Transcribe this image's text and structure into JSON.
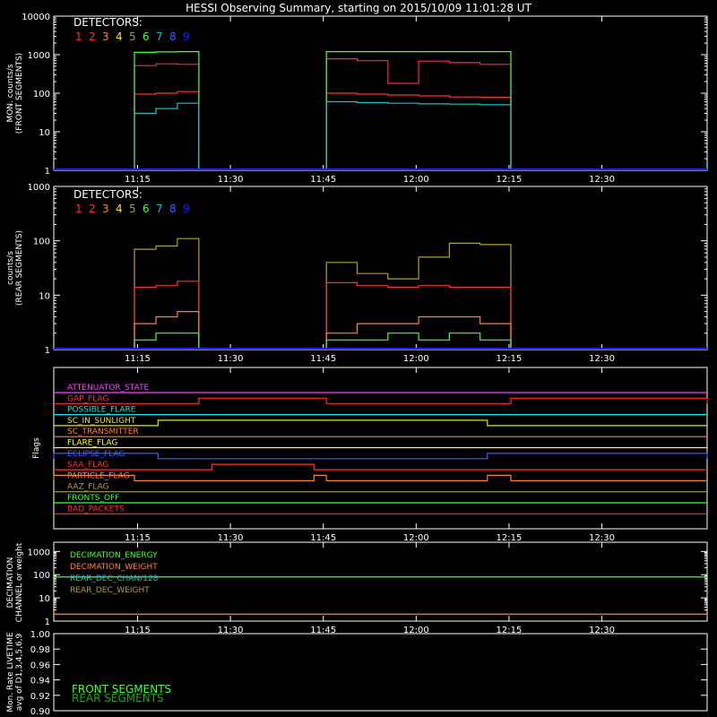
{
  "title": "HESSI Observing Summary, starting on 2015/10/09 11:01:28 UT",
  "colors": {
    "bg": "#000000",
    "axis": "#ffffff",
    "det": [
      "#ff2060",
      "#ff3030",
      "#ff8040",
      "#ffe040",
      "#b0a030",
      "#40ff40",
      "#20c0c0",
      "#4060ff",
      "#2020ff"
    ]
  },
  "x_ticks": [
    "11:15",
    "11:30",
    "11:45",
    "12:00",
    "12:15",
    "12:30"
  ],
  "x_tick_minutes": [
    15,
    30,
    45,
    60,
    75,
    90
  ],
  "x_range_minutes": [
    1.47,
    107
  ],
  "panels": {
    "front": {
      "ylabel_1": "MON. counts/s",
      "ylabel_2": "(FRONT SEGMENTS)",
      "yticks": [
        "1",
        "10",
        "100",
        "1000",
        "10000"
      ],
      "legend_title": "DETECTORS:",
      "legend_numbers": [
        "1",
        "2",
        "3",
        "4",
        "5",
        "6",
        "7",
        "8",
        "9"
      ]
    },
    "rear": {
      "ylabel_1": "counts/s",
      "ylabel_2": "(REAR SEGMENTS)",
      "yticks": [
        "1",
        "10",
        "100",
        "1000"
      ],
      "legend_title": "DETECTORS:",
      "legend_numbers": [
        "1",
        "2",
        "3",
        "4",
        "5",
        "6",
        "7",
        "8",
        "9"
      ]
    },
    "flags": {
      "ylabel": "Flags",
      "labels": [
        "ATTENUATOR_STATE",
        "GAP_FLAG",
        "POSSIBLE_FLARE",
        "SC_IN_SUNLIGHT",
        "SC_TRANSMITTER",
        "FLARE_FLAG",
        "ECLIPSE_FLAG",
        "SAA_FLAG",
        "PARTICLE_FLAG",
        "AAZ_FLAG",
        "FRONTS_OFF",
        "BAD_PACKETS"
      ],
      "label_colors": [
        "#ff40ff",
        "#ff3030",
        "#20e0e0",
        "#e0e040",
        "#ff8040",
        "#ffff40",
        "#4060ff",
        "#ff3030",
        "#ff8040",
        "#b0a030",
        "#40ff40",
        "#ff3030"
      ]
    },
    "decimation": {
      "ylabel_1": "DECIMATION",
      "ylabel_2": "CHANNEL or weight",
      "yticks": [
        "1",
        "10",
        "100",
        "1000"
      ],
      "labels": [
        "DECIMATION_ENERGY",
        "DECIMATION_WEIGHT",
        "REAR_DEC_CHAN/128",
        "REAR_DEC_WEIGHT"
      ],
      "label_colors": [
        "#40ff40",
        "#ff8040",
        "#20c0c0",
        "#b0a030"
      ]
    },
    "livetime": {
      "ylabel_1": "Mon. Rate LIVETIME",
      "ylabel_2": "avg of D1,3,4,5,6,9",
      "yticks": [
        "0.90",
        "0.92",
        "0.94",
        "0.96",
        "0.98",
        "1.00"
      ],
      "labels": [
        "FRONT SEGMENTS",
        "REAR SEGMENTS"
      ],
      "label_colors": [
        "#40ff40",
        "#20a020"
      ]
    }
  },
  "chart_data": [
    {
      "type": "line",
      "title": "HESSI Observing Summary, starting on 2015/10/09 11:01:28 UT",
      "ylabel": "MON. counts/s (FRONT SEGMENTS)",
      "yscale": "log",
      "ylim": [
        1,
        10000
      ],
      "x_unit": "minutes after 11:00 UT",
      "xlim": [
        1.47,
        107
      ],
      "intervals": [
        [
          14.5,
          24.9
        ],
        [
          45.5,
          75.3
        ]
      ],
      "series": [
        {
          "name": "1",
          "values_int1": [
            520,
            580,
            560
          ],
          "values_int2": [
            780,
            700,
            180,
            680,
            620,
            560
          ]
        },
        {
          "name": "2",
          "values_int1": [
            95,
            100,
            110
          ],
          "values_int2": [
            100,
            95,
            90,
            85,
            80,
            78
          ]
        },
        {
          "name": "6",
          "values_int1": [
            1150,
            1180,
            1200
          ],
          "values_int2": [
            1200,
            1200,
            1200,
            1200,
            1200,
            1200
          ]
        },
        {
          "name": "7",
          "values_int1": [
            30,
            40,
            55
          ],
          "values_int2": [
            60,
            57,
            55,
            53,
            52,
            50
          ]
        }
      ]
    },
    {
      "type": "line",
      "ylabel": "counts/s (REAR SEGMENTS)",
      "yscale": "log",
      "ylim": [
        1,
        1000
      ],
      "x_unit": "minutes after 11:00 UT",
      "intervals": [
        [
          14.5,
          24.9
        ],
        [
          45.5,
          75.3
        ]
      ],
      "series": [
        {
          "name": "5",
          "values_int1": [
            70,
            80,
            110
          ],
          "values_int2": [
            40,
            25,
            20,
            50,
            90,
            85
          ]
        },
        {
          "name": "2",
          "values_int1": [
            14,
            15,
            18
          ],
          "values_int2": [
            17,
            15,
            14,
            15,
            14,
            14
          ]
        },
        {
          "name": "3",
          "values_int1": [
            3,
            4,
            5
          ],
          "values_int2": [
            2,
            3,
            3,
            4,
            4,
            3
          ]
        },
        {
          "name": "6",
          "values_int1": [
            1.5,
            2,
            2
          ],
          "values_int2": [
            1.5,
            1.5,
            2,
            1.5,
            2,
            1.5
          ]
        }
      ]
    },
    {
      "type": "line",
      "ylabel": "Flags",
      "x_unit": "minutes after 11:00 UT",
      "flags": [
        {
          "name": "GAP_FLAG",
          "on": [
            [
              24.9,
              45.5
            ],
            [
              75.3,
              107
            ]
          ]
        },
        {
          "name": "SC_IN_SUNLIGHT",
          "on": [
            [
              18.3,
              71.5
            ]
          ]
        },
        {
          "name": "ECLIPSE_FLAG",
          "on": [
            [
              1.47,
              18.3
            ],
            [
              71.5,
              107
            ]
          ]
        },
        {
          "name": "SAA_FLAG",
          "on": [
            [
              27,
              43.5
            ]
          ]
        },
        {
          "name": "PARTICLE_FLAG",
          "on": [
            [
              1.47,
              14.5
            ],
            [
              43.5,
              45.5
            ],
            [
              71.5,
              75.3
            ]
          ]
        }
      ]
    },
    {
      "type": "line",
      "ylabel": "DECIMATION CHANNEL or weight",
      "yscale": "log",
      "ylim": [
        0.5,
        1000
      ],
      "series": [
        {
          "name": "DECIMATION_ENERGY",
          "values": [
            40,
            40
          ]
        },
        {
          "name": "DECIMATION_WEIGHT",
          "values": [
            1,
            1
          ]
        }
      ]
    },
    {
      "type": "line",
      "ylabel": "Mon. Rate LIVETIME avg of D1,3,4,5,6,9",
      "ylim": [
        0.9,
        1.0
      ],
      "series": [
        {
          "name": "FRONT SEGMENTS",
          "values": []
        },
        {
          "name": "REAR SEGMENTS",
          "values": []
        }
      ]
    }
  ]
}
